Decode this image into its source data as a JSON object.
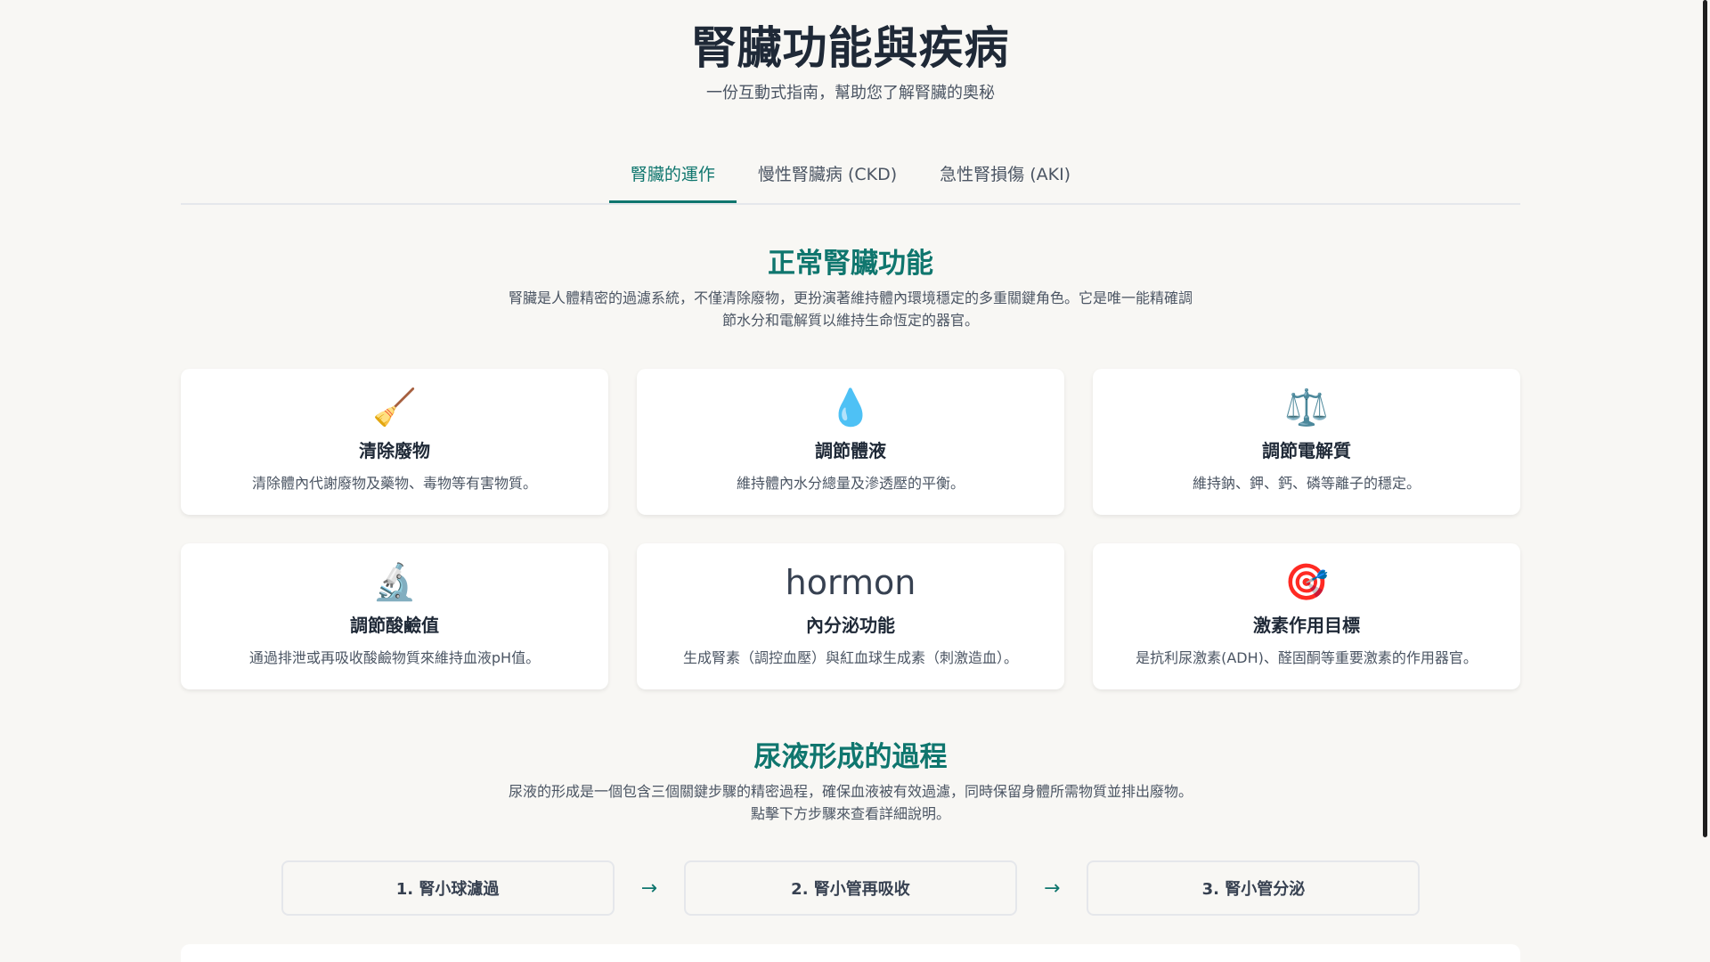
{
  "header": {
    "title": "腎臟功能與疾病",
    "subtitle": "一份互動式指南，幫助您了解腎臟的奧秘"
  },
  "tabs": [
    {
      "label": "腎臟的運作",
      "active": true
    },
    {
      "label": "慢性腎臟病 (CKD)",
      "active": false
    },
    {
      "label": "急性腎損傷 (AKI)",
      "active": false
    }
  ],
  "normal_function": {
    "title": "正常腎臟功能",
    "description": "腎臟是人體精密的過濾系統，不僅清除廢物，更扮演著維持體內環境穩定的多重關鍵角色。它是唯一能精確調節水分和電解質以維持生命恆定的器官。"
  },
  "cards": [
    {
      "icon": "🧹",
      "icon_name": "broom-icon",
      "title": "清除廢物",
      "desc": "清除體內代謝廢物及藥物、毒物等有害物質。"
    },
    {
      "icon": "💧",
      "icon_name": "water-drop-icon",
      "title": "調節體液",
      "desc": "維持體內水分總量及滲透壓的平衡。"
    },
    {
      "icon": "⚖️",
      "icon_name": "balance-scale-icon",
      "title": "調節電解質",
      "desc": "維持鈉、鉀、鈣、磷等離子的穩定。"
    },
    {
      "icon": "🔬",
      "icon_name": "microscope-icon",
      "title": "調節酸鹼值",
      "desc": "通過排泄或再吸收酸鹼物質來維持血液pH值。"
    },
    {
      "icon": "hormon",
      "icon_name": "hormone-text-icon",
      "title": "內分泌功能",
      "desc": "生成腎素（調控血壓）與紅血球生成素（刺激造血）。"
    },
    {
      "icon": "🎯",
      "icon_name": "target-icon",
      "title": "激素作用目標",
      "desc": "是抗利尿激素(ADH)、醛固酮等重要激素的作用器官。"
    }
  ],
  "urine_formation": {
    "title": "尿液形成的過程",
    "description_line1": "尿液的形成是一個包含三個關鍵步驟的精密過程，確保血液被有效過濾，同時保留身體所需物質並排出廢物。",
    "description_line2": "點擊下方步驟來查看詳細說明。"
  },
  "steps": [
    {
      "label": "1. 腎小球濾過"
    },
    {
      "label": "2. 腎小管再吸收"
    },
    {
      "label": "3. 腎小管分泌"
    }
  ],
  "arrow_symbol": "→"
}
